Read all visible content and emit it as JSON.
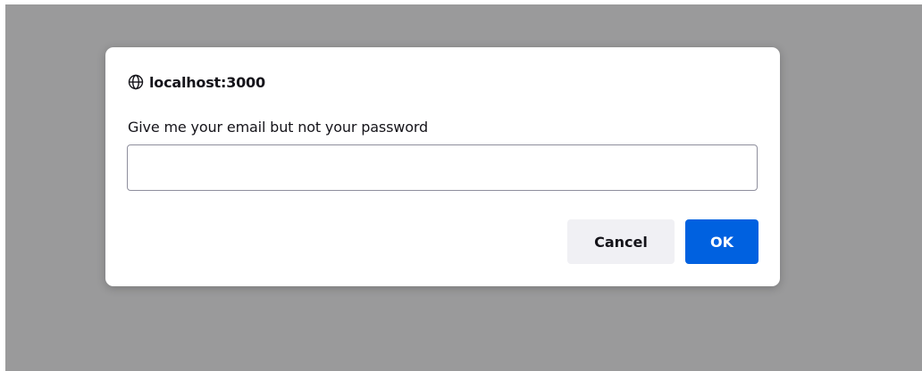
{
  "dialog": {
    "origin": "localhost:3000",
    "origin_icon": "globe-icon",
    "message": "Give me your email but not your password",
    "input": {
      "value": "",
      "placeholder": ""
    },
    "cancel_label": "Cancel",
    "ok_label": "OK"
  },
  "colors": {
    "overlay": "#9a9a9b",
    "primary_button": "#0061e0",
    "secondary_button": "#f0f0f4"
  }
}
